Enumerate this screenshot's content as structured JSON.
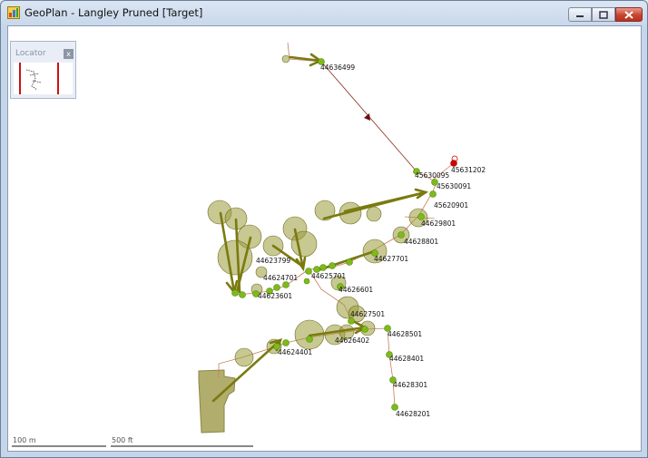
{
  "window": {
    "title": "GeoPlan - Langley Pruned [Target]"
  },
  "locator": {
    "title": "Locator",
    "close_glyph": "x"
  },
  "scale_bars": [
    {
      "label": "100 m"
    },
    {
      "label": "500 ft"
    }
  ],
  "nodes": {
    "n1": "44636499",
    "n2": "45631202",
    "n3": "45630095",
    "n4": "45630091",
    "n5": "45620901",
    "n6": "44629801",
    "n7": "44628801",
    "n8": "44627701",
    "n9": "44623799",
    "n10": "44625701",
    "n11": "44624701",
    "n12": "44623601",
    "n13": "44626601",
    "n14": "44627501",
    "n15": "44626402",
    "n16": "44624401",
    "n17": "44628501",
    "n18": "44628401",
    "n19": "44628301",
    "n20": "44628201"
  },
  "colors": {
    "pipe": "#c97a5e",
    "node": "#7fba1a",
    "arrow": "#7a7a10",
    "catchment": "#8a8a20",
    "outfall": "#d10000"
  },
  "icons": {
    "app": "geoplan-app-icon",
    "minimize": "minimize-icon",
    "maximize": "maximize-icon",
    "close": "close-icon"
  }
}
